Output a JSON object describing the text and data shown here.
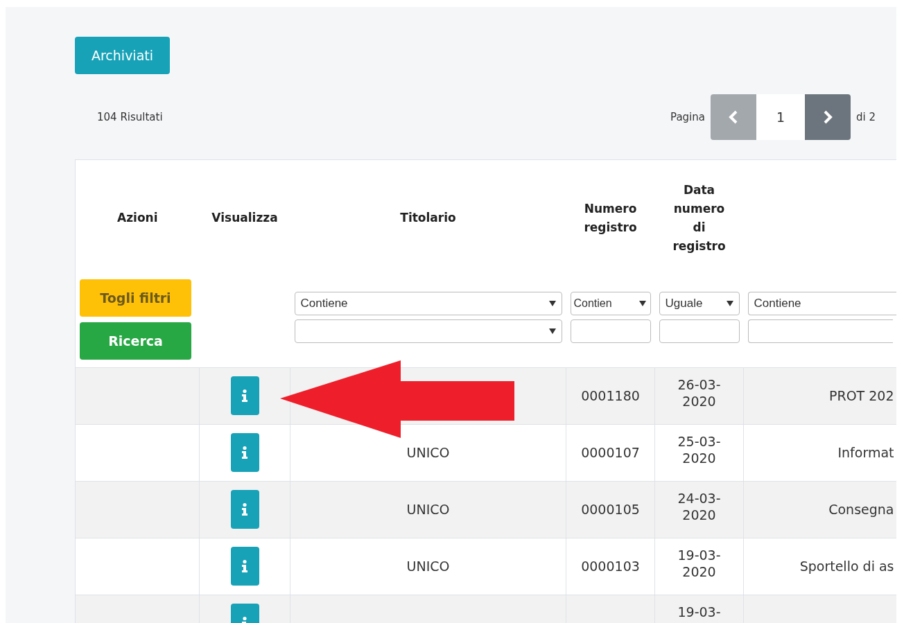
{
  "archive_button": "Archiviati",
  "results": "104 Risultati",
  "pagination": {
    "label": "Pagina",
    "page": "1",
    "total": "di 2",
    "prev_disabled": true
  },
  "table": {
    "columns": [
      "Azioni",
      "Visualizza",
      "Titolario",
      "Numero registro",
      "Data numero di registro"
    ],
    "filters": [
      {
        "kind": "buttons",
        "buttons": [
          {
            "label": "Togli filtri",
            "kind": "warning"
          },
          {
            "label": "Ricerca",
            "kind": "success"
          }
        ]
      },
      {
        "kind": "none"
      },
      {
        "kind": "filter",
        "operator": "Contiene",
        "second": {
          "kind": "select"
        }
      },
      {
        "kind": "filter",
        "operator": "Contien",
        "second": {
          "kind": "input"
        }
      },
      {
        "kind": "filter",
        "operator": "Uguale",
        "second": {
          "kind": "input"
        }
      },
      {
        "kind": "filter",
        "operator": "Contiene",
        "second": {
          "kind": "input"
        }
      }
    ],
    "rows": [
      {
        "numero": "0001180",
        "data": "26-03-2020",
        "descr": "PROT 202"
      },
      {
        "titolario": "UNICO",
        "numero": "0000107",
        "data": "25-03-2020",
        "descr": "Informat"
      },
      {
        "titolario": "UNICO",
        "numero": "0000105",
        "data": "24-03-2020",
        "descr": "Consegna"
      },
      {
        "titolario": "UNICO",
        "numero": "0000103",
        "data": "19-03-2020",
        "descr": "Sportello di as"
      },
      {
        "data": "19-03-"
      }
    ]
  }
}
